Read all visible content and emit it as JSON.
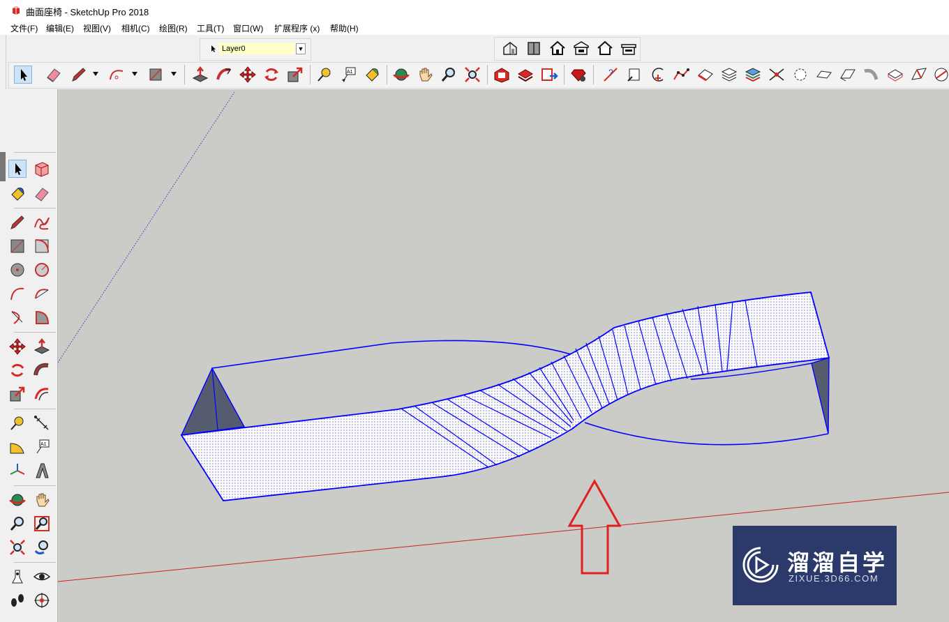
{
  "window": {
    "title": "曲面座椅 - SketchUp Pro 2018"
  },
  "menu": [
    "文件(F)",
    "编辑(E)",
    "视图(V)",
    "相机(C)",
    "绘图(R)",
    "工具(T)",
    "窗口(W)",
    "扩展程序 (x)",
    "帮助(H)"
  ],
  "layers": {
    "current": "Layer0"
  },
  "views_toolbar": [
    "iso-view-icon",
    "top-view-icon",
    "front-view-icon",
    "right-view-icon",
    "back-view-icon",
    "left-view-icon"
  ],
  "main_toolbar": [
    "select-icon",
    "eraser-icon",
    "pencil-icon",
    "arc-icon",
    "rectangle-icon",
    "push-pull-icon",
    "follow-me-icon",
    "move-icon",
    "rotate-icon",
    "scale-icon",
    "tape-measure-icon",
    "text-icon",
    "paint-bucket-icon",
    "orbit-icon",
    "pan-icon",
    "zoom-icon",
    "zoom-extents-icon",
    "warehouse-icon",
    "extension-warehouse-icon",
    "send-to-layout-icon",
    "ruby-console-icon",
    "plugin-icons"
  ],
  "left_toolbar": [
    "select-icon",
    "component-icon",
    "paint-bucket-icon",
    "eraser-icon",
    "line-icon",
    "freehand-icon",
    "rectangle-icon",
    "rotated-rectangle-icon",
    "circle-icon",
    "polygon-icon",
    "arc-icon",
    "two-point-arc-icon",
    "three-point-arc-icon",
    "pie-icon",
    "move-icon",
    "push-pull-icon",
    "rotate-icon",
    "follow-me-icon",
    "scale-icon",
    "offset-icon",
    "tape-measure-icon",
    "dimension-icon",
    "protractor-icon",
    "text-icon",
    "axes-icon",
    "3d-text-icon",
    "orbit-icon",
    "pan-icon",
    "zoom-icon",
    "zoom-window-icon",
    "zoom-extents-icon",
    "previous-view-icon",
    "position-camera-icon",
    "look-around-icon",
    "walk-icon",
    "section-plane-icon"
  ],
  "watermark": {
    "title": "溜溜自学",
    "subtitle": "ZIXUE.3D66.COM"
  },
  "colors": {
    "edge": "#0000ff",
    "viewport": "#cbcbc7",
    "annotation_arrow": "#e02020",
    "axis_red": "#cc2222",
    "axis_blue": "#3333cc"
  }
}
